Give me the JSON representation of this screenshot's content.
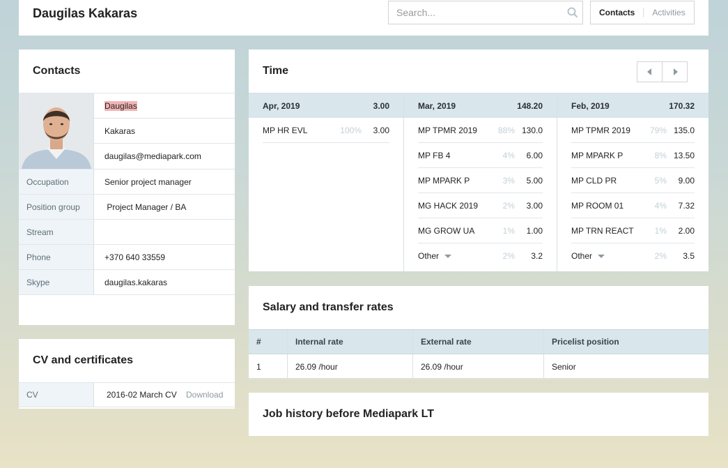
{
  "header": {
    "name": "Daugilas Kakaras",
    "search_placeholder": "Search...",
    "tabs": [
      {
        "label": "Contacts",
        "active": true
      },
      {
        "label": "Activities",
        "active": false
      }
    ]
  },
  "contacts": {
    "title": "Contacts",
    "first_name": "Daugilas",
    "last_name": "Kakaras",
    "email": "daugilas@mediapark.com",
    "fields": [
      {
        "label": "Occupation",
        "value": "Senior project manager"
      },
      {
        "label": "Position group",
        "value": " Project Manager / BA"
      },
      {
        "label": "Stream",
        "value": ""
      },
      {
        "label": "Phone",
        "value": "+370 640 33559"
      },
      {
        "label": "Skype",
        "value": "daugilas.kakaras"
      }
    ]
  },
  "cv": {
    "title": "CV and certificates",
    "label": "CV",
    "file": "2016-02 March CV",
    "download": "Download"
  },
  "time": {
    "title": "Time",
    "months": [
      {
        "month": "Apr, 2019",
        "total": "3.00",
        "rows": [
          {
            "project": "MP HR EVL",
            "pct": "100%",
            "hours": "3.00"
          }
        ]
      },
      {
        "month": "Mar, 2019",
        "total": "148.20",
        "rows": [
          {
            "project": "MP TPMR 2019",
            "pct": "88%",
            "hours": "130.0"
          },
          {
            "project": "MP FB 4",
            "pct": "4%",
            "hours": "6.00"
          },
          {
            "project": "MP MPARK P",
            "pct": "3%",
            "hours": "5.00"
          },
          {
            "project": "MG HACK 2019",
            "pct": "2%",
            "hours": "3.00"
          },
          {
            "project": "MG GROW UA",
            "pct": "1%",
            "hours": "1.00"
          },
          {
            "project": "Other",
            "pct": "2%",
            "hours": "3.2",
            "dropdown": true
          }
        ]
      },
      {
        "month": "Feb, 2019",
        "total": "170.32",
        "rows": [
          {
            "project": "MP TPMR 2019",
            "pct": "79%",
            "hours": "135.0"
          },
          {
            "project": "MP MPARK P",
            "pct": "8%",
            "hours": "13.50"
          },
          {
            "project": "MP CLD PR",
            "pct": "5%",
            "hours": "9.00"
          },
          {
            "project": "MP ROOM 01",
            "pct": "4%",
            "hours": "7.32"
          },
          {
            "project": "MP TRN REACT",
            "pct": "1%",
            "hours": "2.00"
          },
          {
            "project": "Other",
            "pct": "2%",
            "hours": "3.5",
            "dropdown": true
          }
        ]
      }
    ]
  },
  "salary": {
    "title": "Salary and transfer rates",
    "columns": [
      "#",
      "Internal rate",
      "External rate",
      "Pricelist position"
    ],
    "rows": [
      [
        "1",
        "26.09 /hour",
        "26.09 /hour",
        "Senior"
      ]
    ]
  },
  "job_history": {
    "title": "Job history before Mediapark LT"
  },
  "colors": {
    "header_row_bg": "#d9e6ec",
    "label_bg": "#eef4f7",
    "muted_text": "#8d9aa0",
    "highlight": "#f4b4b4"
  }
}
